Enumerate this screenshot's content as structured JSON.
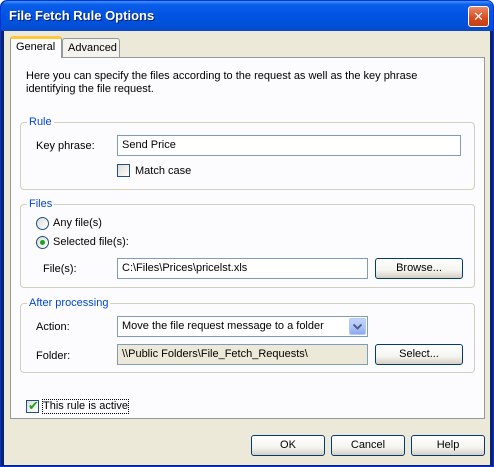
{
  "window": {
    "title": "File Fetch Rule Options",
    "close_symbol": "✕"
  },
  "tabs": [
    {
      "label": "General",
      "selected": true
    },
    {
      "label": "Advanced",
      "selected": false
    }
  ],
  "intro_text": "Here you can specify the files according to the request as well as the key phrase identifying the file request.",
  "rule": {
    "legend": "Rule",
    "key_phrase_label": "Key phrase:",
    "key_phrase_value": "Send Price",
    "match_case_label": "Match case",
    "match_case_checked": false
  },
  "files": {
    "legend": "Files",
    "any_files_label": "Any file(s)",
    "selected_files_label": "Selected file(s):",
    "selected_option": "selected",
    "files_label": "File(s):",
    "files_value": "C:\\Files\\Prices\\pricelst.xls",
    "browse_label": "Browse..."
  },
  "after_processing": {
    "legend": "After processing",
    "action_label": "Action:",
    "action_value": "Move the file request message to a folder",
    "folder_label": "Folder:",
    "folder_value": "\\\\Public Folders\\File_Fetch_Requests\\",
    "select_label": "Select..."
  },
  "rule_active": {
    "label": "This rule is active",
    "checked": true
  },
  "buttons": {
    "ok": "OK",
    "cancel": "Cancel",
    "help": "Help"
  },
  "colors": {
    "title_bar": "#0054e3",
    "legend_text": "#0046d5",
    "dialog_bg": "#ece9d8",
    "check_green": "#21a121"
  }
}
